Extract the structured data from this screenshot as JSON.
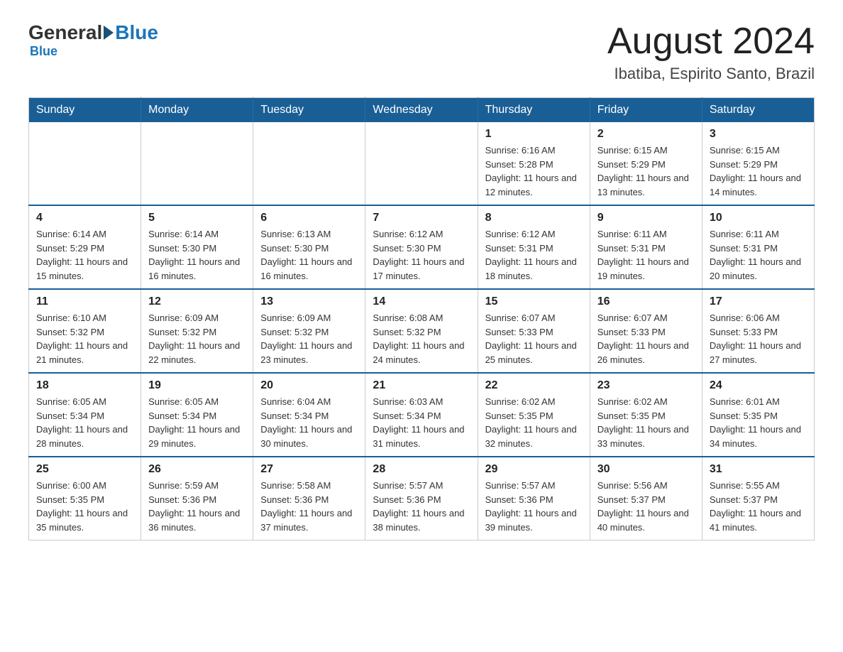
{
  "header": {
    "logo": {
      "general": "General",
      "blue": "Blue"
    },
    "month": "August 2024",
    "location": "Ibatiba, Espirito Santo, Brazil"
  },
  "days_of_week": [
    "Sunday",
    "Monday",
    "Tuesday",
    "Wednesday",
    "Thursday",
    "Friday",
    "Saturday"
  ],
  "weeks": [
    {
      "days": [
        {
          "number": "",
          "info": ""
        },
        {
          "number": "",
          "info": ""
        },
        {
          "number": "",
          "info": ""
        },
        {
          "number": "",
          "info": ""
        },
        {
          "number": "1",
          "info": "Sunrise: 6:16 AM\nSunset: 5:28 PM\nDaylight: 11 hours and 12 minutes."
        },
        {
          "number": "2",
          "info": "Sunrise: 6:15 AM\nSunset: 5:29 PM\nDaylight: 11 hours and 13 minutes."
        },
        {
          "number": "3",
          "info": "Sunrise: 6:15 AM\nSunset: 5:29 PM\nDaylight: 11 hours and 14 minutes."
        }
      ]
    },
    {
      "days": [
        {
          "number": "4",
          "info": "Sunrise: 6:14 AM\nSunset: 5:29 PM\nDaylight: 11 hours and 15 minutes."
        },
        {
          "number": "5",
          "info": "Sunrise: 6:14 AM\nSunset: 5:30 PM\nDaylight: 11 hours and 16 minutes."
        },
        {
          "number": "6",
          "info": "Sunrise: 6:13 AM\nSunset: 5:30 PM\nDaylight: 11 hours and 16 minutes."
        },
        {
          "number": "7",
          "info": "Sunrise: 6:12 AM\nSunset: 5:30 PM\nDaylight: 11 hours and 17 minutes."
        },
        {
          "number": "8",
          "info": "Sunrise: 6:12 AM\nSunset: 5:31 PM\nDaylight: 11 hours and 18 minutes."
        },
        {
          "number": "9",
          "info": "Sunrise: 6:11 AM\nSunset: 5:31 PM\nDaylight: 11 hours and 19 minutes."
        },
        {
          "number": "10",
          "info": "Sunrise: 6:11 AM\nSunset: 5:31 PM\nDaylight: 11 hours and 20 minutes."
        }
      ]
    },
    {
      "days": [
        {
          "number": "11",
          "info": "Sunrise: 6:10 AM\nSunset: 5:32 PM\nDaylight: 11 hours and 21 minutes."
        },
        {
          "number": "12",
          "info": "Sunrise: 6:09 AM\nSunset: 5:32 PM\nDaylight: 11 hours and 22 minutes."
        },
        {
          "number": "13",
          "info": "Sunrise: 6:09 AM\nSunset: 5:32 PM\nDaylight: 11 hours and 23 minutes."
        },
        {
          "number": "14",
          "info": "Sunrise: 6:08 AM\nSunset: 5:32 PM\nDaylight: 11 hours and 24 minutes."
        },
        {
          "number": "15",
          "info": "Sunrise: 6:07 AM\nSunset: 5:33 PM\nDaylight: 11 hours and 25 minutes."
        },
        {
          "number": "16",
          "info": "Sunrise: 6:07 AM\nSunset: 5:33 PM\nDaylight: 11 hours and 26 minutes."
        },
        {
          "number": "17",
          "info": "Sunrise: 6:06 AM\nSunset: 5:33 PM\nDaylight: 11 hours and 27 minutes."
        }
      ]
    },
    {
      "days": [
        {
          "number": "18",
          "info": "Sunrise: 6:05 AM\nSunset: 5:34 PM\nDaylight: 11 hours and 28 minutes."
        },
        {
          "number": "19",
          "info": "Sunrise: 6:05 AM\nSunset: 5:34 PM\nDaylight: 11 hours and 29 minutes."
        },
        {
          "number": "20",
          "info": "Sunrise: 6:04 AM\nSunset: 5:34 PM\nDaylight: 11 hours and 30 minutes."
        },
        {
          "number": "21",
          "info": "Sunrise: 6:03 AM\nSunset: 5:34 PM\nDaylight: 11 hours and 31 minutes."
        },
        {
          "number": "22",
          "info": "Sunrise: 6:02 AM\nSunset: 5:35 PM\nDaylight: 11 hours and 32 minutes."
        },
        {
          "number": "23",
          "info": "Sunrise: 6:02 AM\nSunset: 5:35 PM\nDaylight: 11 hours and 33 minutes."
        },
        {
          "number": "24",
          "info": "Sunrise: 6:01 AM\nSunset: 5:35 PM\nDaylight: 11 hours and 34 minutes."
        }
      ]
    },
    {
      "days": [
        {
          "number": "25",
          "info": "Sunrise: 6:00 AM\nSunset: 5:35 PM\nDaylight: 11 hours and 35 minutes."
        },
        {
          "number": "26",
          "info": "Sunrise: 5:59 AM\nSunset: 5:36 PM\nDaylight: 11 hours and 36 minutes."
        },
        {
          "number": "27",
          "info": "Sunrise: 5:58 AM\nSunset: 5:36 PM\nDaylight: 11 hours and 37 minutes."
        },
        {
          "number": "28",
          "info": "Sunrise: 5:57 AM\nSunset: 5:36 PM\nDaylight: 11 hours and 38 minutes."
        },
        {
          "number": "29",
          "info": "Sunrise: 5:57 AM\nSunset: 5:36 PM\nDaylight: 11 hours and 39 minutes."
        },
        {
          "number": "30",
          "info": "Sunrise: 5:56 AM\nSunset: 5:37 PM\nDaylight: 11 hours and 40 minutes."
        },
        {
          "number": "31",
          "info": "Sunrise: 5:55 AM\nSunset: 5:37 PM\nDaylight: 11 hours and 41 minutes."
        }
      ]
    }
  ]
}
